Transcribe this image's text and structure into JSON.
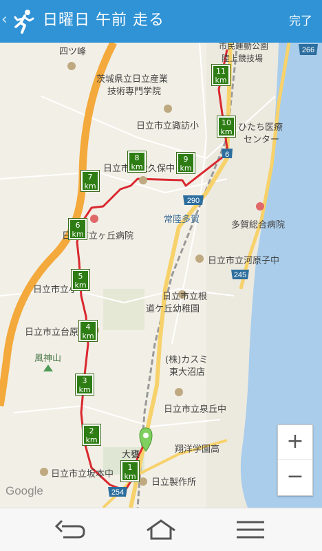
{
  "header": {
    "title": "日曜日 午前 走る",
    "done_label": "完了"
  },
  "map": {
    "distance_markers": [
      {
        "num": "1",
        "unit": "km"
      },
      {
        "num": "2",
        "unit": "km"
      },
      {
        "num": "3",
        "unit": "km"
      },
      {
        "num": "4",
        "unit": "km"
      },
      {
        "num": "5",
        "unit": "km"
      },
      {
        "num": "6",
        "unit": "km"
      },
      {
        "num": "7",
        "unit": "km"
      },
      {
        "num": "8",
        "unit": "km"
      },
      {
        "num": "9",
        "unit": "km"
      },
      {
        "num": "10",
        "unit": "km"
      },
      {
        "num": "11",
        "unit": "km"
      }
    ],
    "place_labels": [
      "四ツ峰",
      "市民運動公園",
      "陸上競技場",
      "茨城県立日立産業",
      "技術専門学院",
      "日立市立諏訪小",
      "ひたち医療",
      "センター",
      "日立市立大久保中",
      "常陸多賀",
      "多賀総合病院",
      "日立市立ヶ丘病院",
      "日立市立河原子中",
      "日立市立小",
      "日立市立根",
      "道ケ丘幼稚園",
      "日立市立台原",
      "風神山",
      "(株)カスミ",
      "東大沼店",
      "日立市立泉丘中",
      "大甕",
      "翔洋学園高",
      "日立市立坂本中",
      "日立製作所"
    ],
    "road_shields": [
      "266",
      "6",
      "290",
      "245",
      "254"
    ],
    "attribution": "Google"
  },
  "zoom": {
    "in_label": "+",
    "out_label": "−"
  },
  "icons": {
    "runner": "runner-icon",
    "back": "back-icon",
    "home": "home-icon",
    "menu": "menu-icon"
  }
}
